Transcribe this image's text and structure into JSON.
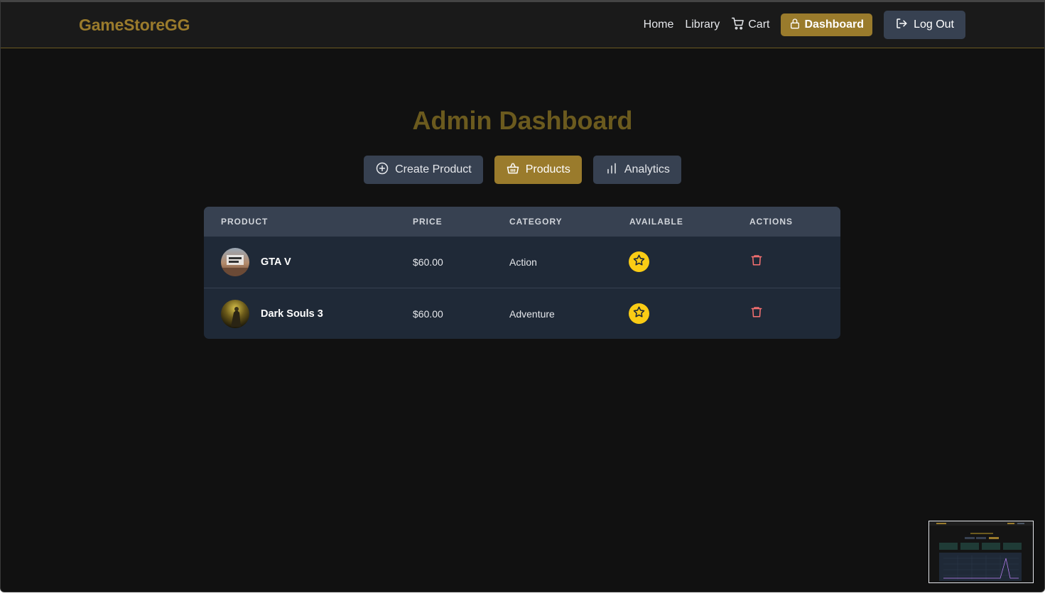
{
  "nav": {
    "brand": "GameStoreGG",
    "home": "Home",
    "library": "Library",
    "cart": "Cart",
    "dashboard": "Dashboard",
    "logout": "Log Out"
  },
  "page": {
    "title": "Admin Dashboard"
  },
  "tabs": [
    {
      "label": "Create Product",
      "icon": "plus-circle-icon"
    },
    {
      "label": "Products",
      "icon": "basket-icon",
      "active": true
    },
    {
      "label": "Analytics",
      "icon": "bar-chart-icon"
    }
  ],
  "table": {
    "headers": [
      "PRODUCT",
      "PRICE",
      "CATEGORY",
      "AVAILABLE",
      "ACTIONS"
    ],
    "rows": [
      {
        "name": "GTA V",
        "price": "$60.00",
        "category": "Action"
      },
      {
        "name": "Dark Souls 3",
        "price": "$60.00",
        "category": "Adventure"
      }
    ]
  },
  "colors": {
    "accent": "#9a7b2c",
    "background": "#111111",
    "surface": "#1f2937",
    "star": "#facc15",
    "danger": "#f87171"
  }
}
